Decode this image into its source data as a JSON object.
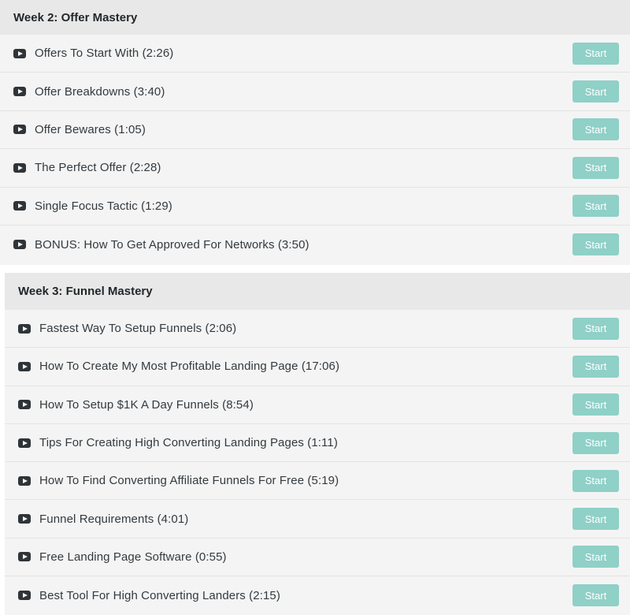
{
  "sections": [
    {
      "title": "Week 2: Offer Mastery",
      "lessons": [
        {
          "title": "Offers To Start With (2:26)",
          "button": "Start"
        },
        {
          "title": "Offer Breakdowns (3:40)",
          "button": "Start"
        },
        {
          "title": "Offer Bewares (1:05)",
          "button": "Start"
        },
        {
          "title": "The Perfect Offer (2:28)",
          "button": "Start"
        },
        {
          "title": "Single Focus Tactic (1:29)",
          "button": "Start"
        },
        {
          "title": "BONUS: How To Get Approved For Networks (3:50)",
          "button": "Start"
        }
      ]
    },
    {
      "title": "Week 3: Funnel Mastery",
      "lessons": [
        {
          "title": "Fastest Way To Setup Funnels (2:06)",
          "button": "Start"
        },
        {
          "title": "How To Create My Most Profitable Landing Page (17:06)",
          "button": "Start"
        },
        {
          "title": "How To Setup $1K A Day Funnels (8:54)",
          "button": "Start"
        },
        {
          "title": "Tips For Creating High Converting Landing Pages (1:11)",
          "button": "Start"
        },
        {
          "title": "How To Find Converting Affiliate Funnels For Free (5:19)",
          "button": "Start"
        },
        {
          "title": "Funnel Requirements (4:01)",
          "button": "Start"
        },
        {
          "title": "Free Landing Page Software (0:55)",
          "button": "Start"
        },
        {
          "title": "Best Tool For High Converting Landers (2:15)",
          "button": "Start"
        }
      ]
    }
  ],
  "colors": {
    "button_bg": "#8fd0c7",
    "header_bg": "#e8e8e8",
    "row_bg": "#f4f4f4",
    "icon": "play-icon"
  }
}
